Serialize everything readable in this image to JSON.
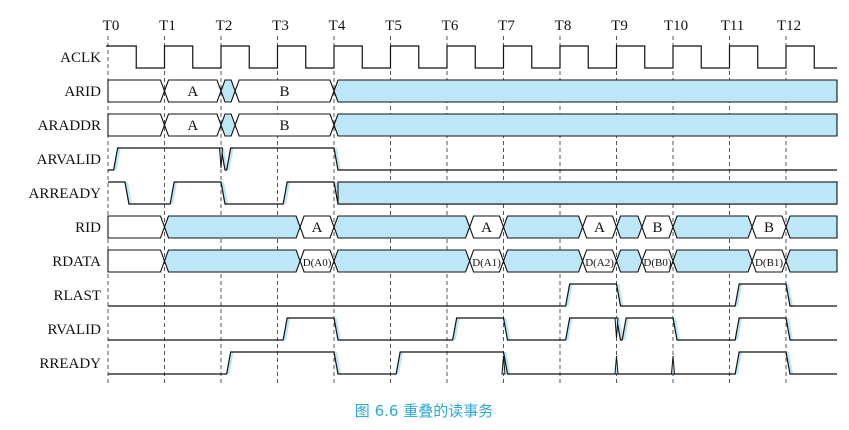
{
  "diagram": {
    "caption": "图 6.6   重叠的读事务",
    "colors": {
      "line": "#111111",
      "fill": "#bde6f6",
      "caption": "#2aa8d8",
      "grid": "#555555"
    },
    "time_labels": [
      "T0",
      "T1",
      "T2",
      "T3",
      "T4",
      "T5",
      "T6",
      "T7",
      "T8",
      "T9",
      "T10",
      "T11",
      "T12"
    ],
    "signals": [
      {
        "id": "aclk",
        "name": "ACLK",
        "type": "clock"
      },
      {
        "id": "arid",
        "name": "ARID",
        "type": "bus",
        "segments": [
          {
            "from": 0,
            "to": 1,
            "label": "",
            "fill": false
          },
          {
            "from": 1,
            "to": 2,
            "label": "A",
            "fill": false
          },
          {
            "from": 2,
            "to": 2.25,
            "label": "",
            "fill": true
          },
          {
            "from": 2.25,
            "to": 4,
            "label": "B",
            "fill": false
          },
          {
            "from": 4,
            "to": 13,
            "label": "",
            "fill": true
          }
        ]
      },
      {
        "id": "araddr",
        "name": "ARADDR",
        "type": "bus",
        "segments": [
          {
            "from": 0,
            "to": 1,
            "label": "",
            "fill": false
          },
          {
            "from": 1,
            "to": 2,
            "label": "A",
            "fill": false
          },
          {
            "from": 2,
            "to": 2.25,
            "label": "",
            "fill": true
          },
          {
            "from": 2.25,
            "to": 4,
            "label": "B",
            "fill": false
          },
          {
            "from": 4,
            "to": 13,
            "label": "",
            "fill": true
          }
        ]
      },
      {
        "id": "arvalid",
        "name": "ARVALID",
        "type": "level",
        "transitions": [
          [
            0,
            0
          ],
          [
            0.1,
            1
          ],
          [
            2,
            0
          ],
          [
            2.1,
            1
          ],
          [
            4,
            0
          ]
        ],
        "pulses": [
          2
        ]
      },
      {
        "id": "arready",
        "name": "ARREADY",
        "type": "level",
        "transitions": [
          [
            0,
            1
          ],
          [
            0.3,
            0
          ],
          [
            1.1,
            1
          ],
          [
            2,
            0
          ],
          [
            3.1,
            1
          ],
          [
            4,
            0
          ]
        ],
        "fill_after": 4
      },
      {
        "id": "rid",
        "name": "RID",
        "type": "bus",
        "segments": [
          {
            "from": 0,
            "to": 1,
            "label": "",
            "fill": false
          },
          {
            "from": 1,
            "to": 3.4,
            "label": "",
            "fill": true
          },
          {
            "from": 3.4,
            "to": 4,
            "label": "A",
            "fill": false
          },
          {
            "from": 4,
            "to": 6.4,
            "label": "",
            "fill": true
          },
          {
            "from": 6.4,
            "to": 7,
            "label": "A",
            "fill": false
          },
          {
            "from": 7,
            "to": 8.4,
            "label": "",
            "fill": true
          },
          {
            "from": 8.4,
            "to": 9,
            "label": "A",
            "fill": false
          },
          {
            "from": 9,
            "to": 9.45,
            "label": "",
            "fill": true
          },
          {
            "from": 9.45,
            "to": 10,
            "label": "B",
            "fill": false
          },
          {
            "from": 10,
            "to": 11.4,
            "label": "",
            "fill": true
          },
          {
            "from": 11.4,
            "to": 12,
            "label": "B",
            "fill": false
          },
          {
            "from": 12,
            "to": 13,
            "label": "",
            "fill": true
          }
        ]
      },
      {
        "id": "rdata",
        "name": "RDATA",
        "type": "bus",
        "segments": [
          {
            "from": 0,
            "to": 1,
            "label": "",
            "fill": false
          },
          {
            "from": 1,
            "to": 3.4,
            "label": "",
            "fill": true
          },
          {
            "from": 3.4,
            "to": 4,
            "label": "D(A0)",
            "fill": false,
            "small": true
          },
          {
            "from": 4,
            "to": 6.4,
            "label": "",
            "fill": true
          },
          {
            "from": 6.4,
            "to": 7,
            "label": "D(A1)",
            "fill": false,
            "small": true
          },
          {
            "from": 7,
            "to": 8.4,
            "label": "",
            "fill": true
          },
          {
            "from": 8.4,
            "to": 9,
            "label": "D(A2)",
            "fill": false,
            "small": true
          },
          {
            "from": 9,
            "to": 9.45,
            "label": "",
            "fill": true
          },
          {
            "from": 9.45,
            "to": 10,
            "label": "D(B0)",
            "fill": false,
            "small": true
          },
          {
            "from": 10,
            "to": 11.4,
            "label": "",
            "fill": true
          },
          {
            "from": 11.4,
            "to": 12,
            "label": "D(B1)",
            "fill": false,
            "small": true
          },
          {
            "from": 12,
            "to": 13,
            "label": "",
            "fill": true
          }
        ]
      },
      {
        "id": "rlast",
        "name": "RLAST",
        "type": "level",
        "transitions": [
          [
            0,
            0
          ],
          [
            8.1,
            1
          ],
          [
            9,
            0
          ],
          [
            11.1,
            1
          ],
          [
            12,
            0
          ]
        ]
      },
      {
        "id": "rvalid",
        "name": "RVALID",
        "type": "level",
        "transitions": [
          [
            0,
            0
          ],
          [
            3.1,
            1
          ],
          [
            4,
            0
          ],
          [
            6.1,
            1
          ],
          [
            7,
            0
          ],
          [
            8.1,
            1
          ],
          [
            9,
            0
          ],
          [
            9.1,
            1
          ],
          [
            10,
            0
          ],
          [
            11.1,
            1
          ],
          [
            12,
            0
          ]
        ],
        "pulses": [
          9
        ]
      },
      {
        "id": "rready",
        "name": "RREADY",
        "type": "level",
        "transitions": [
          [
            0,
            0
          ],
          [
            2.1,
            1
          ],
          [
            4,
            0
          ],
          [
            5.1,
            1
          ],
          [
            7,
            0
          ],
          [
            9,
            0
          ],
          [
            11.1,
            1
          ],
          [
            12,
            0
          ]
        ],
        "pulses_down": [
          7,
          9,
          10
        ]
      }
    ]
  }
}
